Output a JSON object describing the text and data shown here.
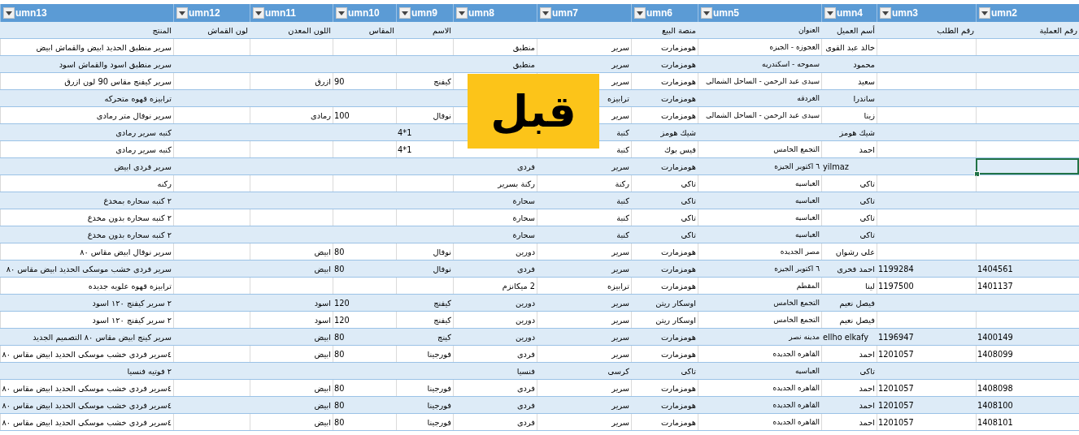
{
  "columns": [
    "umn2",
    "umn3",
    "umn4",
    "umn5",
    "umn6",
    "umn7",
    "umn8",
    "umn9",
    "umn10",
    "umn11",
    "umn12",
    "umn13"
  ],
  "rows": [
    {
      "selected": false,
      "cells": [
        "رقم العملية",
        "رقم الطلب",
        "أسم العميل",
        "العنوان",
        "منصة البيع",
        null,
        null,
        "الاسم",
        "المقاس",
        "اللون المعدن",
        "لون القماش",
        "المنتج"
      ]
    },
    {
      "selected": false,
      "cells": [
        null,
        null,
        "خالد عبد القوى",
        "العجوزه - الجيزه",
        "هومزمارت",
        "سرير",
        "منطبق",
        null,
        null,
        null,
        null,
        "سرير منطبق الحديد ابيض والقماش ابيض"
      ]
    },
    {
      "selected": false,
      "cells": [
        null,
        null,
        "محمود",
        "سموحه - اسكندريه",
        "هومزمارت",
        "سرير",
        "منطبق",
        null,
        null,
        null,
        null,
        "سرير منطبق اسود والقماش اسود"
      ]
    },
    {
      "selected": false,
      "cells": [
        null,
        null,
        "سعيد",
        "سيدى عبد الرحمن - الساحل الشمالى",
        "هومزمارت",
        "سرير",
        null,
        "كيفنج",
        "90",
        "ازرق",
        null,
        "سرير كيفنج مقاس 90 لون ازرق"
      ]
    },
    {
      "selected": false,
      "cells": [
        null,
        null,
        "ساندرا",
        "الغردقه",
        "هومزمارت",
        "ترابيزه",
        null,
        null,
        null,
        null,
        null,
        "ترابيزه قهوه متحركه"
      ]
    },
    {
      "selected": false,
      "cells": [
        null,
        null,
        "زينا",
        "سيدى عبد الرحمن - الساحل الشمالى",
        "هومزمارت",
        "سرير",
        null,
        "نوفال",
        "100",
        "رمادى",
        null,
        "سرير نوفال متر رمادى"
      ]
    },
    {
      "selected": false,
      "cells": [
        null,
        null,
        "شيك هومز",
        null,
        "شيك هومز",
        "كنبة",
        null,
        "4*1",
        null,
        null,
        null,
        "كنبه سرير رمادى"
      ]
    },
    {
      "selected": false,
      "cells": [
        null,
        null,
        "احمد",
        "التجمع الخامس",
        "فيس بوك",
        "كنبة",
        null,
        "4*1",
        null,
        null,
        null,
        "كنبه سرير رمادى"
      ]
    },
    {
      "selected": true,
      "cells": [
        null,
        null,
        "yilmaz",
        "٦ اكتوبر الجيزه",
        "هومزمارت",
        "سرير",
        "فردى",
        null,
        null,
        null,
        null,
        "سرير فردى ابيض"
      ]
    },
    {
      "selected": false,
      "cells": [
        null,
        null,
        "تاكى",
        "العباسيه",
        "تاكى",
        "ركنة",
        "ركنة بسرير",
        null,
        null,
        null,
        null,
        "ركنه"
      ]
    },
    {
      "selected": false,
      "cells": [
        null,
        null,
        "تاكى",
        "العباسيه",
        "تاكى",
        "كنبة",
        "سحارة",
        null,
        null,
        null,
        null,
        "٢ كنبه سحاره بمخدع"
      ]
    },
    {
      "selected": false,
      "cells": [
        null,
        null,
        "تاكى",
        "العباسيه",
        "تاكى",
        "كنبة",
        "سحارة",
        null,
        null,
        null,
        null,
        "٢ كنبه سحاره بدون مخدع"
      ]
    },
    {
      "selected": false,
      "cells": [
        null,
        null,
        "تاكى",
        "العباسيه",
        "تاكى",
        "كنبة",
        "سحارة",
        null,
        null,
        null,
        null,
        "٢ كنبه سحاره بدون مخدع"
      ]
    },
    {
      "selected": false,
      "cells": [
        null,
        null,
        "على رشوان",
        "مصر الجديده",
        "هومزمارت",
        "سرير",
        "دورين",
        "نوفال",
        "80",
        "ابيض",
        null,
        "سرير نوفال ابيض مقاس ٨٠"
      ]
    },
    {
      "selected": false,
      "cells": [
        "1404561",
        "1199284",
        "احمد فخرى",
        "٦ اكتوبر الجيزه",
        "هومزمارت",
        "سرير",
        "فردى",
        "نوفال",
        "80",
        "ابيض",
        null,
        "سرير فردى خشب موسكى الحديد ابيض مقاس ٨٠"
      ]
    },
    {
      "selected": false,
      "cells": [
        "1401137",
        "1197500",
        "لينا",
        "المقطم",
        "هومزمارت",
        "ترابيزه",
        "2 ميكانزم",
        null,
        null,
        null,
        null,
        "ترابيزه قهوه علويه جديده"
      ]
    },
    {
      "selected": false,
      "cells": [
        null,
        null,
        "فيصل نعيم",
        "التجمع الخامس",
        "اوسكار ريتن",
        "سرير",
        "دورين",
        "كيفنج",
        "120",
        "اسود",
        null,
        "٢ سرير كيفنج ١٢٠ اسود"
      ]
    },
    {
      "selected": false,
      "cells": [
        null,
        null,
        "فيصل نعيم",
        "التجمع الخامس",
        "اوسكار ريتن",
        "سرير",
        "دورين",
        "كيفنج",
        "120",
        "اسود",
        null,
        "٢ سرير كيفنج ١٢٠ اسود"
      ]
    },
    {
      "selected": false,
      "cells": [
        "1400149",
        "1196947",
        "ellho elkafy",
        "مدينه نصر",
        "هومزمارت",
        "سرير",
        "دورين",
        "كينج",
        "80",
        "ابيض",
        null,
        "سرير كينج ابيض مقاس ٨٠ التصميم الجديد"
      ]
    },
    {
      "selected": false,
      "cells": [
        "1408099",
        "1201057",
        "احمد",
        "القاهره الجديده",
        "هومزمارت",
        "سرير",
        "فردى",
        "فورجينا",
        "80",
        "ابيض",
        null,
        "٤سرير فردى خشب موسكى الحديد ابيض مقاس ٨٠"
      ]
    },
    {
      "selected": false,
      "cells": [
        null,
        null,
        "تاكى",
        "العباسيه",
        "تاكى",
        "كرسى",
        "فنسيا",
        null,
        null,
        null,
        null,
        "٢ فوتيه فنسيا"
      ]
    },
    {
      "selected": false,
      "cells": [
        "1408098",
        "1201057",
        "احمد",
        "القاهره الجديده",
        "هومزمارت",
        "سرير",
        "فردى",
        "فورجينا",
        "80",
        "ابيض",
        null,
        "٤سرير فردى خشب موسكى الحديد ابيض مقاس ٨٠"
      ]
    },
    {
      "selected": false,
      "cells": [
        "1408100",
        "1201057",
        "احمد",
        "القاهره الجديده",
        "هومزمارت",
        "سرير",
        "فردى",
        "فورجينا",
        "80",
        "ابيض",
        null,
        "٤سرير فردى خشب موسكى الحديد ابيض مقاس ٨٠"
      ]
    },
    {
      "selected": false,
      "cells": [
        "1408101",
        "1201057",
        "احمد",
        "القاهره الجديده",
        "هومزمارت",
        "سرير",
        "فردى",
        "فورجينا",
        "80",
        "ابيض",
        null,
        "٤سرير فردى خشب موسكى الحديد ابيض مقاس ٨٠"
      ]
    }
  ],
  "badge": {
    "text": "قبل"
  }
}
